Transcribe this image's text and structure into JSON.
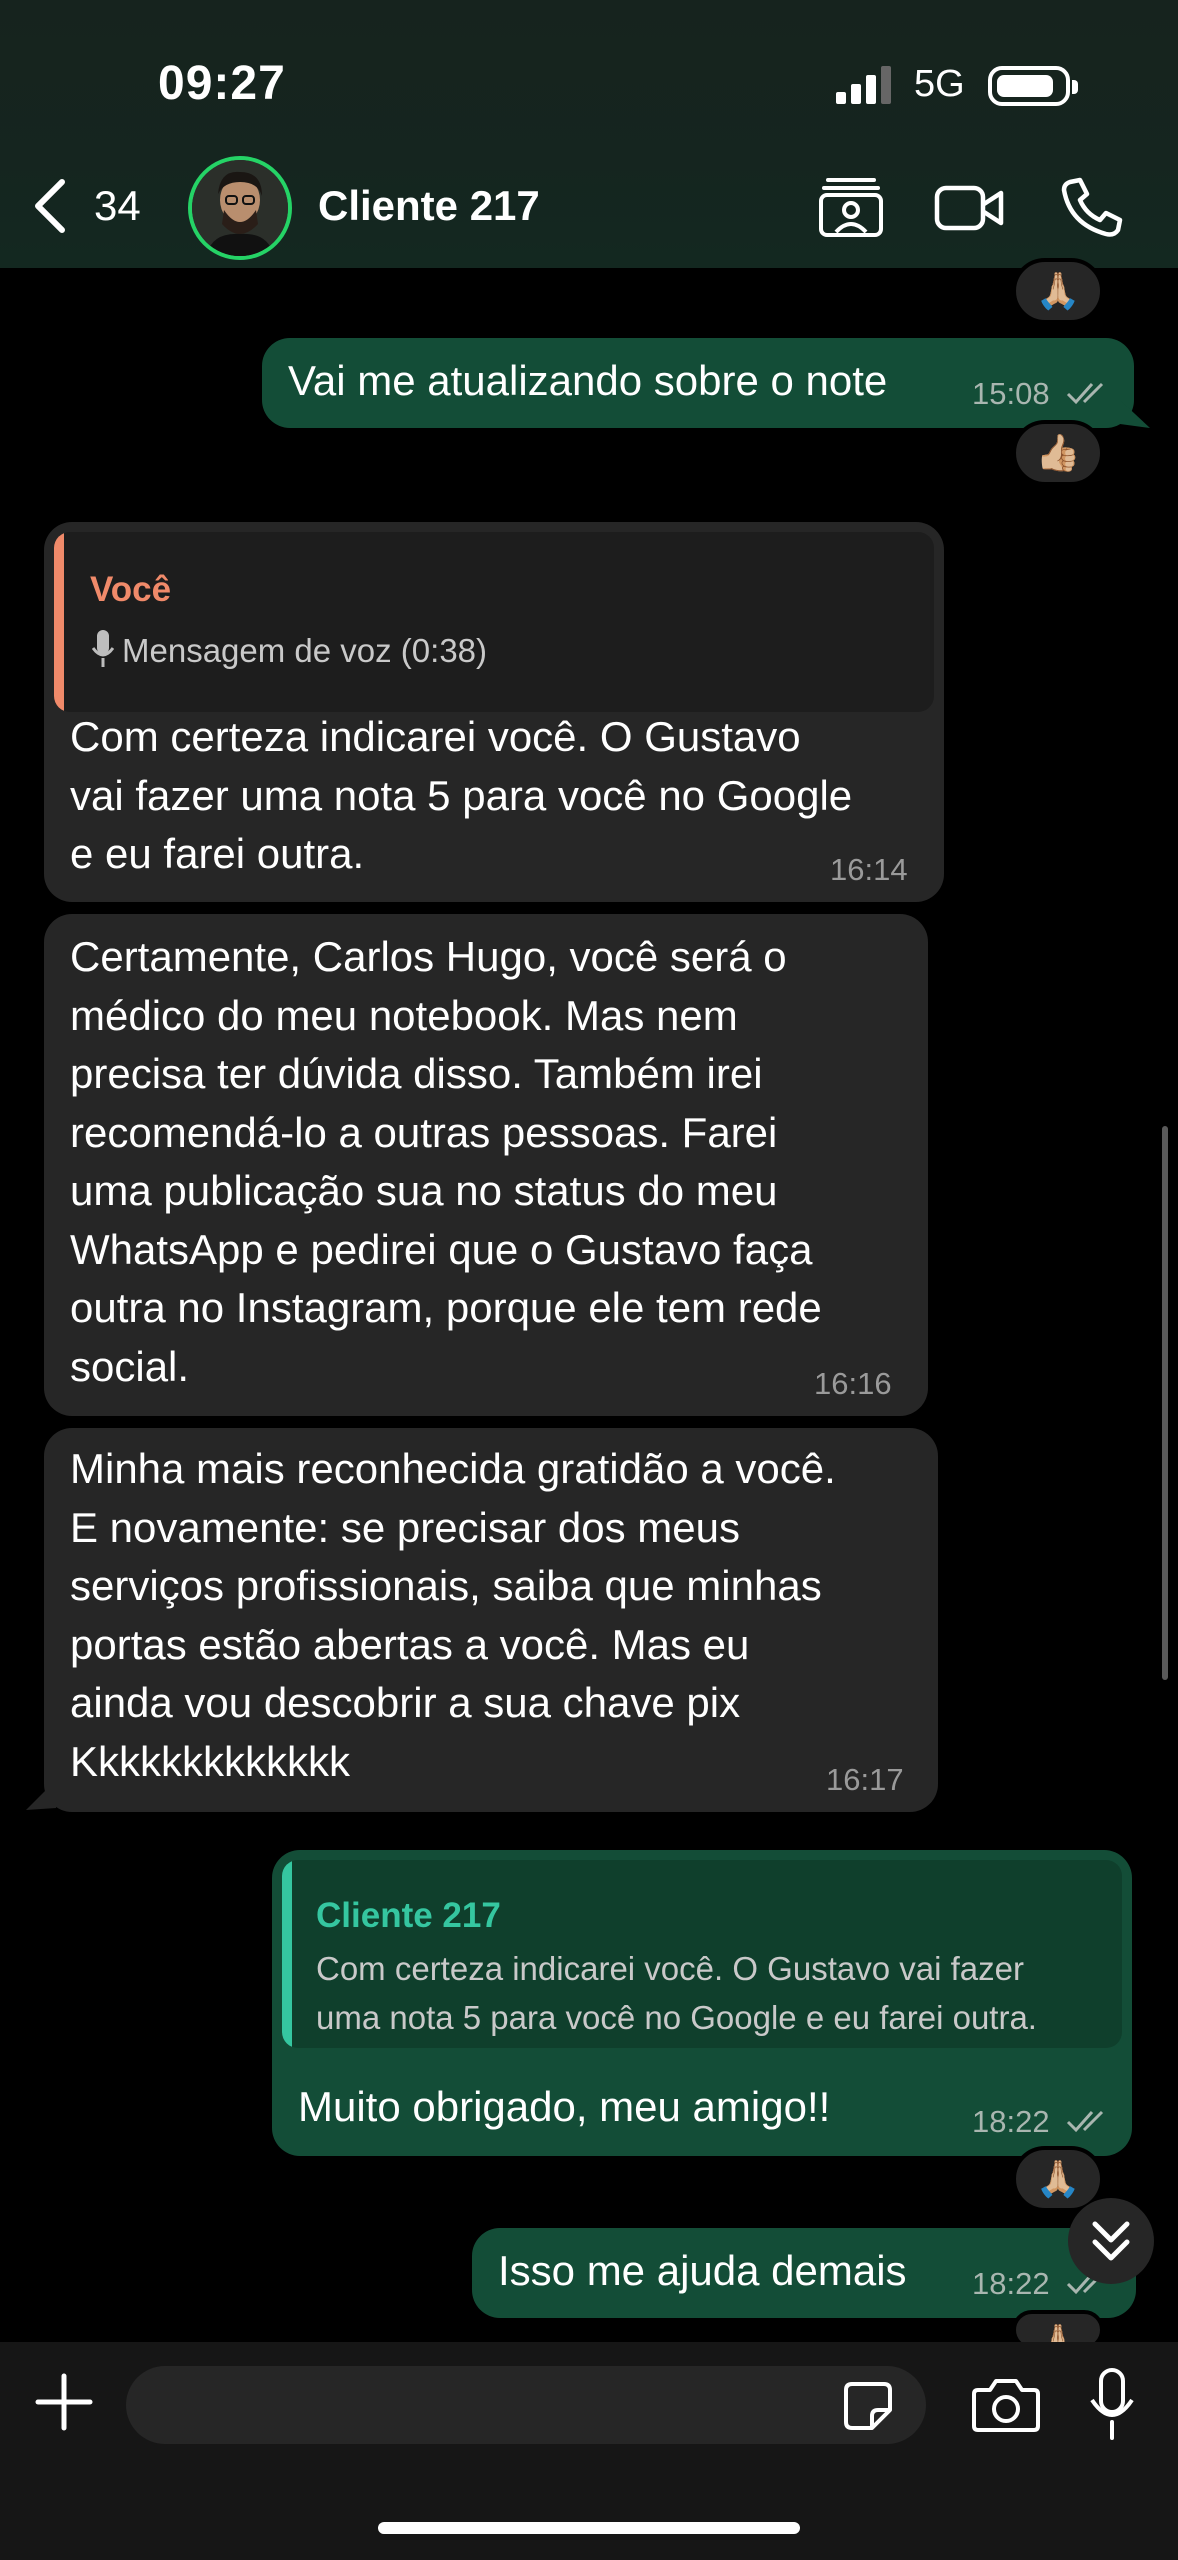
{
  "status_bar": {
    "time": "09:27",
    "network": "5G"
  },
  "header": {
    "unread_count": "34",
    "contact_name": "Cliente 217"
  },
  "messages": [
    {
      "id": "m1",
      "direction": "out",
      "text": "Vai me atualizando sobre o note",
      "time": "15:08",
      "reaction": "👍🏼"
    },
    {
      "id": "m2",
      "direction": "in",
      "quote_author": "Você",
      "quote_text": "Mensagem de voz (0:38)",
      "text": "Com certeza indicarei você. O Gustavo\nvai fazer uma nota 5 para você no Google\ne eu farei outra.",
      "time": "16:14"
    },
    {
      "id": "m3",
      "direction": "in",
      "text": "Certamente, Carlos Hugo, você será o\nmédico do meu notebook. Mas nem\nprecisa ter dúvida disso. Também irei\nrecomendá-lo a outras pessoas. Farei\numa publicação sua no status do meu\nWhatsApp e  pedirei que o Gustavo faça\noutra no Instagram, porque ele tem rede\nsocial.",
      "time": "16:16"
    },
    {
      "id": "m4",
      "direction": "in",
      "text": "Minha mais reconhecida gratidão a você.\nE novamente: se precisar dos meus\nserviços profissionais, saiba que minhas\nportas estão abertas a você. Mas eu\nainda vou descobrir a sua chave pix\nKkkkkkkkkkkkk",
      "time": "16:17"
    },
    {
      "id": "m5",
      "direction": "out",
      "quote_author": "Cliente 217",
      "quote_text": "Com certeza indicarei você. O Gustavo vai fazer\numa nota 5 para você no Google e eu farei outra.",
      "text": "Muito obrigado, meu amigo!!",
      "time": "18:22",
      "reaction": "🙏🏼"
    },
    {
      "id": "m6",
      "direction": "out",
      "text": "Isso me ajuda demais",
      "time": "18:22",
      "reaction": "🙏🏼"
    }
  ],
  "top_reaction": "🙏🏼",
  "colors": {
    "outgoing_bubble": "#134d37",
    "incoming_bubble": "#262626",
    "accent_green": "#25d366",
    "quote_you": "#f08a6a",
    "quote_contact": "#35c6a0"
  },
  "icons": [
    "back-icon",
    "contacts-icon",
    "video-call-icon",
    "phone-icon",
    "mic-icon",
    "double-check-icon",
    "chevron-double-down-icon",
    "plus-icon",
    "sticker-icon",
    "camera-icon"
  ]
}
